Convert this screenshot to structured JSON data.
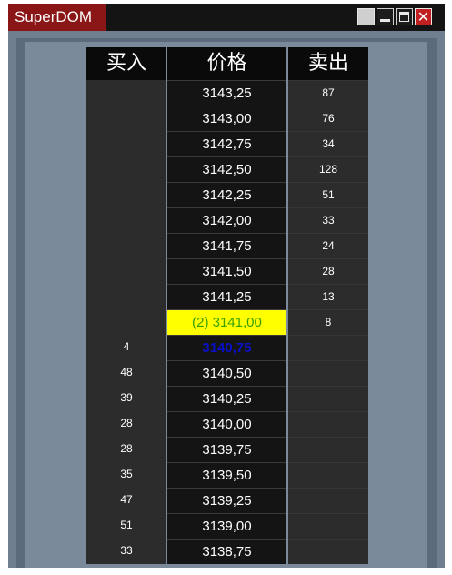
{
  "window": {
    "title": "SuperDOM",
    "buttons": [
      "pin",
      "minimize",
      "maximize",
      "close"
    ]
  },
  "dom": {
    "headers": {
      "buy": "买入",
      "price": "价格",
      "sell": "卖出"
    },
    "last_price_label": "(2) 3141,00",
    "rows": [
      {
        "price": "3143,25",
        "buy": "",
        "sell": "87"
      },
      {
        "price": "3143,00",
        "buy": "",
        "sell": "76"
      },
      {
        "price": "3142,75",
        "buy": "",
        "sell": "34"
      },
      {
        "price": "3142,50",
        "buy": "",
        "sell": "128"
      },
      {
        "price": "3142,25",
        "buy": "",
        "sell": "51"
      },
      {
        "price": "3142,00",
        "buy": "",
        "sell": "33"
      },
      {
        "price": "3141,75",
        "buy": "",
        "sell": "24"
      },
      {
        "price": "3141,50",
        "buy": "",
        "sell": "28"
      },
      {
        "price": "3141,25",
        "buy": "",
        "sell": "13"
      },
      {
        "price": "(2) 3141,00",
        "buy": "",
        "sell": "8",
        "state": "last"
      },
      {
        "price": "3140,75",
        "buy": "4",
        "sell": "",
        "state": "bid"
      },
      {
        "price": "3140,50",
        "buy": "48",
        "sell": ""
      },
      {
        "price": "3140,25",
        "buy": "39",
        "sell": ""
      },
      {
        "price": "3140,00",
        "buy": "28",
        "sell": ""
      },
      {
        "price": "3139,75",
        "buy": "28",
        "sell": ""
      },
      {
        "price": "3139,50",
        "buy": "35",
        "sell": ""
      },
      {
        "price": "3139,25",
        "buy": "47",
        "sell": ""
      },
      {
        "price": "3139,00",
        "buy": "51",
        "sell": ""
      },
      {
        "price": "3138,75",
        "buy": "33",
        "sell": ""
      }
    ]
  },
  "colors": {
    "title_tab": "#8a1616",
    "last_price_bg": "#ffff00",
    "last_price_text": "#3aa000",
    "bid_text": "#0a10c8",
    "frame_bg": "#7a8a9a"
  }
}
